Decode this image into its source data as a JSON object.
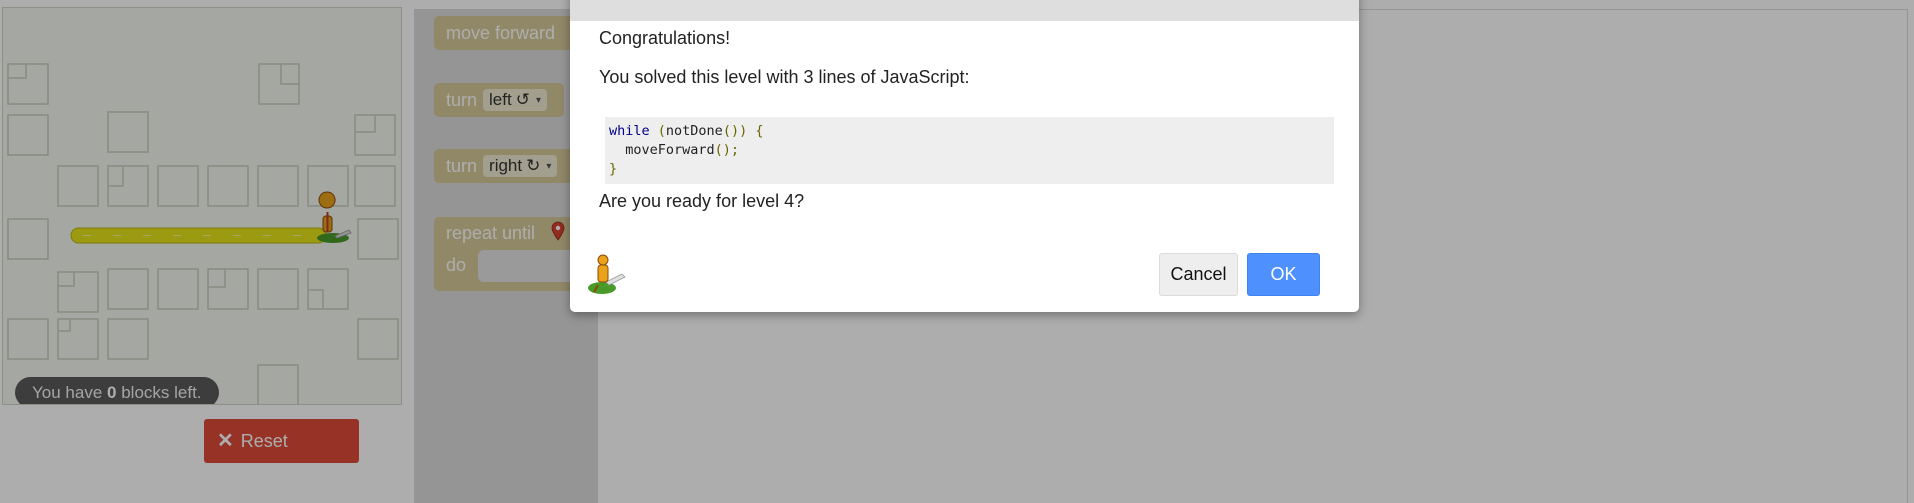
{
  "maze": {
    "blocks_left_prefix": "You have",
    "blocks_left_count": "0",
    "blocks_left_suffix": "blocks left.",
    "reset_label": "Reset"
  },
  "toolbox": {
    "move_forward": "move forward",
    "turn": "turn",
    "left": "left",
    "left_symbol": "↺",
    "right": "right",
    "right_symbol": "↻",
    "dropdown_arrow": "▾",
    "repeat_until": "repeat until",
    "do": "do"
  },
  "dialog": {
    "line1": "Congratulations!",
    "line2": "You solved this level with 3 lines of JavaScript:",
    "code": {
      "kw_while": "while",
      "paren_open": " (",
      "fn_not_done": "notDone",
      "parens_close": "()) {",
      "indent_call": "  moveForward",
      "call_end": "();",
      "brace_close": "}"
    },
    "line3": "Are you ready for level 4?",
    "cancel_label": "Cancel",
    "ok_label": "OK"
  },
  "colors": {
    "reset": "#dd4b39",
    "ok": "#4d90fe",
    "path": "#e5e41a",
    "block": "#d6c99a"
  }
}
